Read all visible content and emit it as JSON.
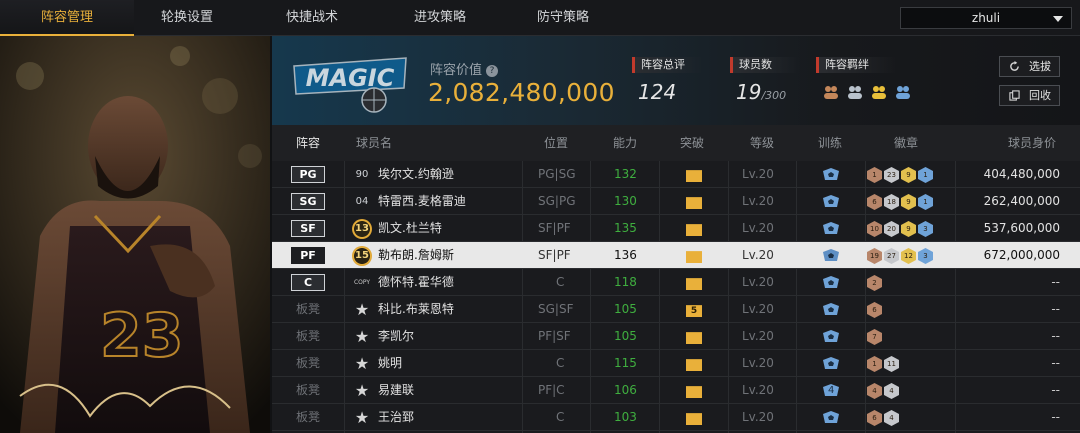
{
  "nav": {
    "tabs": [
      "阵容管理",
      "轮换设置",
      "快捷战术",
      "进攻策略",
      "防守策略"
    ],
    "active_index": 0,
    "team_select_value": "zhuli"
  },
  "header": {
    "lineup_value_label": "阵容价值",
    "lineup_value": "2,082,480,000",
    "total_rating_label": "阵容总评",
    "total_rating": "124",
    "player_count_label": "球员数",
    "player_count": "19",
    "player_count_max": "/300",
    "bonds_label": "阵容羁绊",
    "select_button": "选拔",
    "recycle_button": "回收"
  },
  "table": {
    "headers": [
      "阵容",
      "球员名",
      "位置",
      "能力",
      "突破",
      "等级",
      "训练",
      "徽章",
      "球员身价"
    ],
    "rows": [
      {
        "slot": "PG",
        "bench": false,
        "num": "90",
        "num_style": "plain",
        "name": "埃尔文.约翰逊",
        "position": "PG|SG",
        "ability": "132",
        "ability_green": true,
        "breakthrough": "",
        "level": "Lv.20",
        "badges": [
          [
            "1",
            "bronze"
          ],
          [
            "23",
            "silver"
          ],
          [
            "9",
            "gold"
          ],
          [
            "1",
            "blue"
          ]
        ],
        "value": "404,480,000",
        "highlight": false
      },
      {
        "slot": "SG",
        "bench": false,
        "num": "04",
        "num_style": "plain",
        "name": "特雷西.麦格雷迪",
        "position": "SG|PG",
        "ability": "130",
        "ability_green": true,
        "breakthrough": "",
        "level": "Lv.20",
        "badges": [
          [
            "6",
            "bronze"
          ],
          [
            "18",
            "silver"
          ],
          [
            "9",
            "gold"
          ],
          [
            "1",
            "blue"
          ]
        ],
        "value": "262,400,000",
        "highlight": false
      },
      {
        "slot": "SF",
        "bench": false,
        "num": "13",
        "num_style": "gold",
        "name": "凯文.杜兰特",
        "position": "SF|PF",
        "ability": "135",
        "ability_green": true,
        "breakthrough": "",
        "level": "Lv.20",
        "badges": [
          [
            "10",
            "bronze"
          ],
          [
            "20",
            "silver"
          ],
          [
            "9",
            "gold"
          ],
          [
            "3",
            "blue"
          ]
        ],
        "value": "537,600,000",
        "highlight": false
      },
      {
        "slot": "PF",
        "bench": false,
        "num": "15",
        "num_style": "gold",
        "name": "勒布朗.詹姆斯",
        "position": "SF|PF",
        "ability": "136",
        "ability_green": false,
        "breakthrough": "",
        "level": "Lv.20",
        "badges": [
          [
            "19",
            "bronze"
          ],
          [
            "27",
            "silver"
          ],
          [
            "12",
            "gold"
          ],
          [
            "3",
            "blue"
          ]
        ],
        "value": "672,000,000",
        "highlight": true
      },
      {
        "slot": "C",
        "bench": false,
        "num": "COPY",
        "num_style": "copy",
        "name": "德怀特.霍华德",
        "position": "C",
        "ability": "118",
        "ability_green": true,
        "breakthrough": "",
        "level": "Lv.20",
        "badges": [
          [
            "2",
            "bronze"
          ]
        ],
        "value": "--",
        "highlight": false
      },
      {
        "slot": "板凳",
        "bench": true,
        "num": "★",
        "num_style": "star",
        "name": "科比.布莱恩特",
        "position": "SG|SF",
        "ability": "105",
        "ability_green": true,
        "breakthrough": "5",
        "level": "Lv.20",
        "badges": [
          [
            "6",
            "bronze"
          ]
        ],
        "value": "--",
        "highlight": false
      },
      {
        "slot": "板凳",
        "bench": true,
        "num": "★",
        "num_style": "star",
        "name": "李凯尔",
        "position": "PF|SF",
        "ability": "105",
        "ability_green": true,
        "breakthrough": "",
        "level": "Lv.20",
        "badges": [
          [
            "7",
            "bronze"
          ]
        ],
        "value": "--",
        "highlight": false
      },
      {
        "slot": "板凳",
        "bench": true,
        "num": "★",
        "num_style": "star",
        "name": "姚明",
        "position": "C",
        "ability": "115",
        "ability_green": true,
        "breakthrough": "",
        "level": "Lv.20",
        "badges": [
          [
            "1",
            "bronze"
          ],
          [
            "11",
            "silver"
          ]
        ],
        "value": "--",
        "highlight": false
      },
      {
        "slot": "板凳",
        "bench": true,
        "num": "★",
        "num_style": "star",
        "name": "易建联",
        "position": "PF|C",
        "ability": "106",
        "ability_green": true,
        "breakthrough": "",
        "level": "Lv.20",
        "train": "4",
        "badges": [
          [
            "4",
            "bronze"
          ],
          [
            "4",
            "silver"
          ]
        ],
        "value": "--",
        "highlight": false
      },
      {
        "slot": "板凳",
        "bench": true,
        "num": "★",
        "num_style": "star",
        "name": "王治郅",
        "position": "C",
        "ability": "103",
        "ability_green": true,
        "breakthrough": "",
        "level": "Lv.20",
        "badges": [
          [
            "6",
            "bronze"
          ],
          [
            "4",
            "silver"
          ]
        ],
        "value": "--",
        "highlight": false
      }
    ]
  },
  "hero": {
    "jersey_number": "23"
  },
  "icons": {
    "help": "help-icon",
    "select": "refresh-icon",
    "recycle": "copy-icon",
    "bond": "team-bond-icon",
    "train": "training-icon",
    "break": "crown-icon"
  }
}
